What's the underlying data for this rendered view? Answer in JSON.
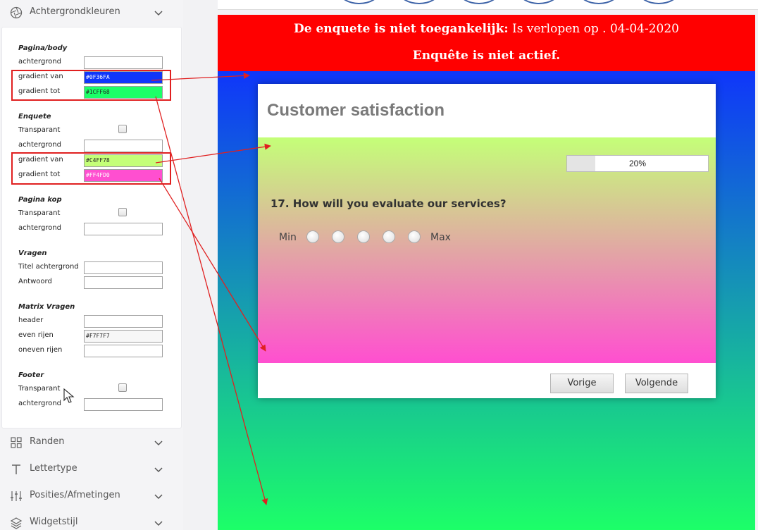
{
  "sidebar": {
    "background_colors_label": "Achtergrondkleuren",
    "borders_label": "Randen",
    "font_label": "Lettertype",
    "positions_label": "Posities/Afmetingen",
    "widget_style_label": "Widgetstijl"
  },
  "settings": {
    "page_body": {
      "title": "Pagina/body",
      "background_label": "achtergrond",
      "background_value": "",
      "gradient_from_label": "gradient van",
      "gradient_from_value": "#0F36FA",
      "gradient_to_label": "gradient tot",
      "gradient_to_value": "#1CFF68"
    },
    "survey": {
      "title": "Enquete",
      "transparent_label": "Transparant",
      "background_label": "achtergrond",
      "background_value": "",
      "gradient_from_label": "gradient van",
      "gradient_from_value": "#C4FF78",
      "gradient_to_label": "gradient tot",
      "gradient_to_value": "#FF4FD0"
    },
    "page_header": {
      "title": "Pagina kop",
      "transparent_label": "Transparant",
      "background_label": "achtergrond",
      "background_value": ""
    },
    "questions": {
      "title": "Vragen",
      "title_background_label": "Titel achtergrond",
      "title_background_value": "",
      "answer_label": "Antwoord",
      "answer_value": ""
    },
    "matrix": {
      "title": "Matrix Vragen",
      "header_label": "header",
      "header_value": "",
      "even_rows_label": "even rijen",
      "even_rows_value": "#F7F7F7",
      "odd_rows_label": "oneven rijen",
      "odd_rows_value": ""
    },
    "footer": {
      "title": "Footer",
      "transparent_label": "Transparant",
      "background_label": "achtergrond",
      "background_value": ""
    }
  },
  "preview": {
    "banner_bold": "De enquete is niet toegankelijk:",
    "banner_rest": " Is verlopen op . 04-04-2020",
    "banner_line2": "Enquête is niet actief.",
    "survey_title": "Customer satisfaction",
    "progress_text": "20%",
    "progress_fraction": 0.2,
    "question": "17. How will you evaluate our services?",
    "scale_min": "Min",
    "scale_max": "Max",
    "prev_button": "Vorige",
    "next_button": "Volgende"
  },
  "colors": {
    "page_gradient_from": "#0F36FA",
    "page_gradient_to": "#1CFF68",
    "survey_gradient_from": "#C4FF78",
    "survey_gradient_to": "#FF4FD0",
    "banner": "#FF0000",
    "annotation": "#E02020"
  }
}
